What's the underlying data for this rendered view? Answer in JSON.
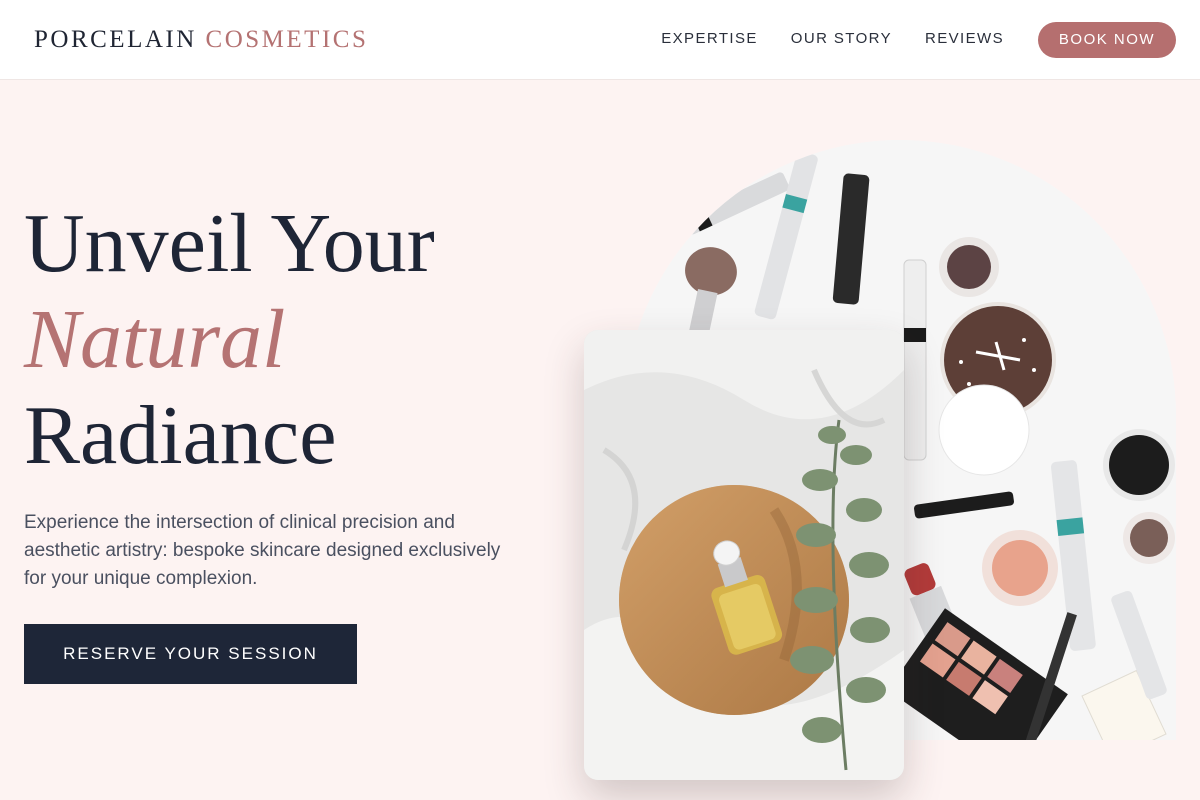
{
  "brand": {
    "name_part1": "PORCELAIN",
    "name_part2": "COSMETICS"
  },
  "nav": {
    "links": [
      "EXPERTISE",
      "OUR STORY",
      "REVIEWS"
    ],
    "cta_label": "BOOK NOW"
  },
  "hero": {
    "headline_line1": "Unveil Your",
    "headline_line2": "Natural",
    "headline_line3": "Radiance",
    "subtext": "Experience the intersection of clinical precision and aesthetic artistry: bespoke skincare designed exclusively for your unique complexion.",
    "cta_label": "RESERVE YOUR SESSION"
  },
  "colors": {
    "accent": "#b57373",
    "navy": "#1e2638",
    "background": "#fdf3f2"
  }
}
